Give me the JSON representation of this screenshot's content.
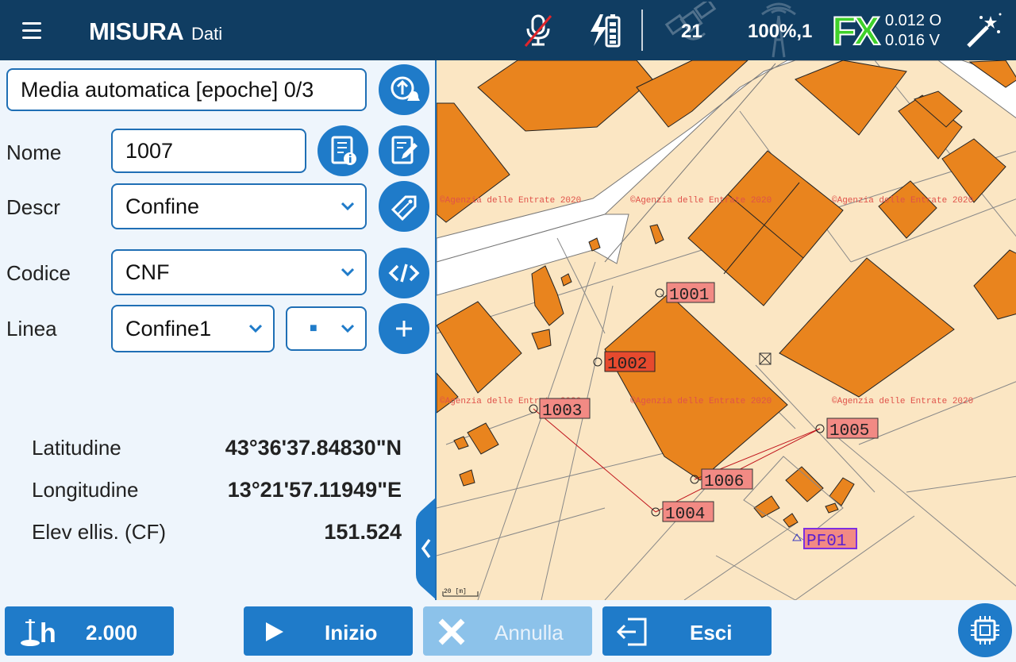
{
  "header": {
    "title": "MISURA",
    "subtitle": "Dati",
    "satellites": "21",
    "percent": "100%,1",
    "fix": "FX",
    "accuracy_h": "0.012 O",
    "accuracy_v": "0.016 V",
    "icons": [
      "menu-icon",
      "microphone-muted-icon",
      "battery-charging-icon",
      "satellite-icon",
      "radio-tower-icon",
      "magic-wand-icon"
    ]
  },
  "form": {
    "mode": "Media automatica [epoche] 0/3",
    "name_label": "Nome",
    "name_value": "1007",
    "descr_label": "Descr",
    "descr_value": "Confine",
    "code_label": "Codice",
    "code_value": "CNF",
    "line_label": "Linea",
    "line_value": "Confine1",
    "line_style_value": "■"
  },
  "position": {
    "lat_label": "Latitudine",
    "lat_value": "43°36'37.84830\"N",
    "lon_label": "Longitudine",
    "lon_value": "13°21'57.11949\"E",
    "elev_label": "Elev ellis. (CF)",
    "elev_value": "151.524"
  },
  "map": {
    "watermark": "©Agenzia delle Entrate 2020",
    "scale_label": "20 [m]",
    "points": [
      "1001",
      "1002",
      "1003",
      "1004",
      "1005",
      "1006",
      "PF01"
    ],
    "colors": {
      "building": "#e9841e",
      "ground": "#fbe6c3",
      "road": "#ffffff",
      "point_label": "#f28a84",
      "selected_point": "#e64a2e",
      "station": "#7e2fe0",
      "line": "#c0141c"
    }
  },
  "footer": {
    "antenna_height": "2.000",
    "start_label": "Inizio",
    "cancel_label": "Annulla",
    "exit_label": "Esci"
  },
  "accent_color": "#1f7bc9"
}
